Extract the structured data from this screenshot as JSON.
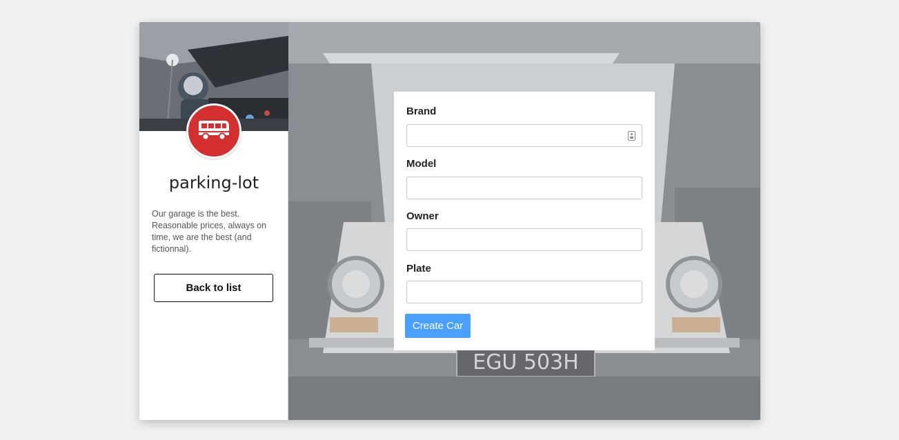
{
  "app": {
    "title": "parking-lot",
    "description": "Our garage is the best. Reasonable prices, always on time, we are the best (and fictionnal).",
    "back_button_label": "Back to list",
    "logo_icon": "bus-icon",
    "logo_color": "#d32f2f"
  },
  "form": {
    "fields": [
      {
        "label": "Brand",
        "value": "",
        "icon": "contact-card-icon"
      },
      {
        "label": "Model",
        "value": ""
      },
      {
        "label": "Owner",
        "value": ""
      },
      {
        "label": "Plate",
        "value": ""
      }
    ],
    "submit_label": "Create Car",
    "submit_color": "#4aa0ff"
  },
  "background": {
    "license_plate": "EGU 503H"
  }
}
